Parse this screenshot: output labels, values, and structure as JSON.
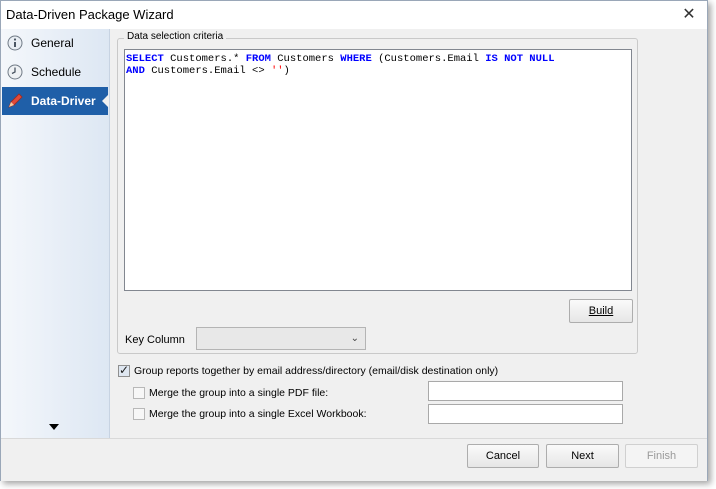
{
  "window": {
    "title": "Data-Driven Package Wizard"
  },
  "sidebar": {
    "items": [
      {
        "label": "General",
        "icon": "info-icon",
        "active": false
      },
      {
        "label": "Schedule",
        "icon": "clock-icon",
        "active": false
      },
      {
        "label": "Data-Driver",
        "icon": "pen-icon",
        "active": true
      }
    ]
  },
  "criteria": {
    "group_label": "Data selection criteria",
    "sql": [
      [
        {
          "t": "SELECT",
          "c": "kw"
        },
        {
          "t": " Customers.* ",
          "c": ""
        },
        {
          "t": "FROM",
          "c": "kw"
        },
        {
          "t": " Customers ",
          "c": ""
        },
        {
          "t": "WHERE",
          "c": "kw"
        },
        {
          "t": " (Customers.Email ",
          "c": ""
        },
        {
          "t": "IS NOT NULL",
          "c": "kw"
        }
      ],
      [
        {
          "t": "AND",
          "c": "kw"
        },
        {
          "t": " Customers.Email <> ",
          "c": ""
        },
        {
          "t": "''",
          "c": "str"
        },
        {
          "t": ")",
          "c": ""
        }
      ]
    ],
    "build_label": "Build",
    "key_column_label": "Key Column",
    "key_column_value": ""
  },
  "options": {
    "group_reports": {
      "label": "Group reports together by email address/directory (email/disk destination only)",
      "checked": true
    },
    "merge_pdf": {
      "label": "Merge the group into a single PDF file:",
      "checked": false,
      "value": ""
    },
    "merge_excel": {
      "label": "Merge the group into a single Excel Workbook:",
      "checked": false,
      "value": ""
    }
  },
  "footer": {
    "cancel_label": "Cancel",
    "next_label": "Next",
    "finish_label": "Finish"
  }
}
